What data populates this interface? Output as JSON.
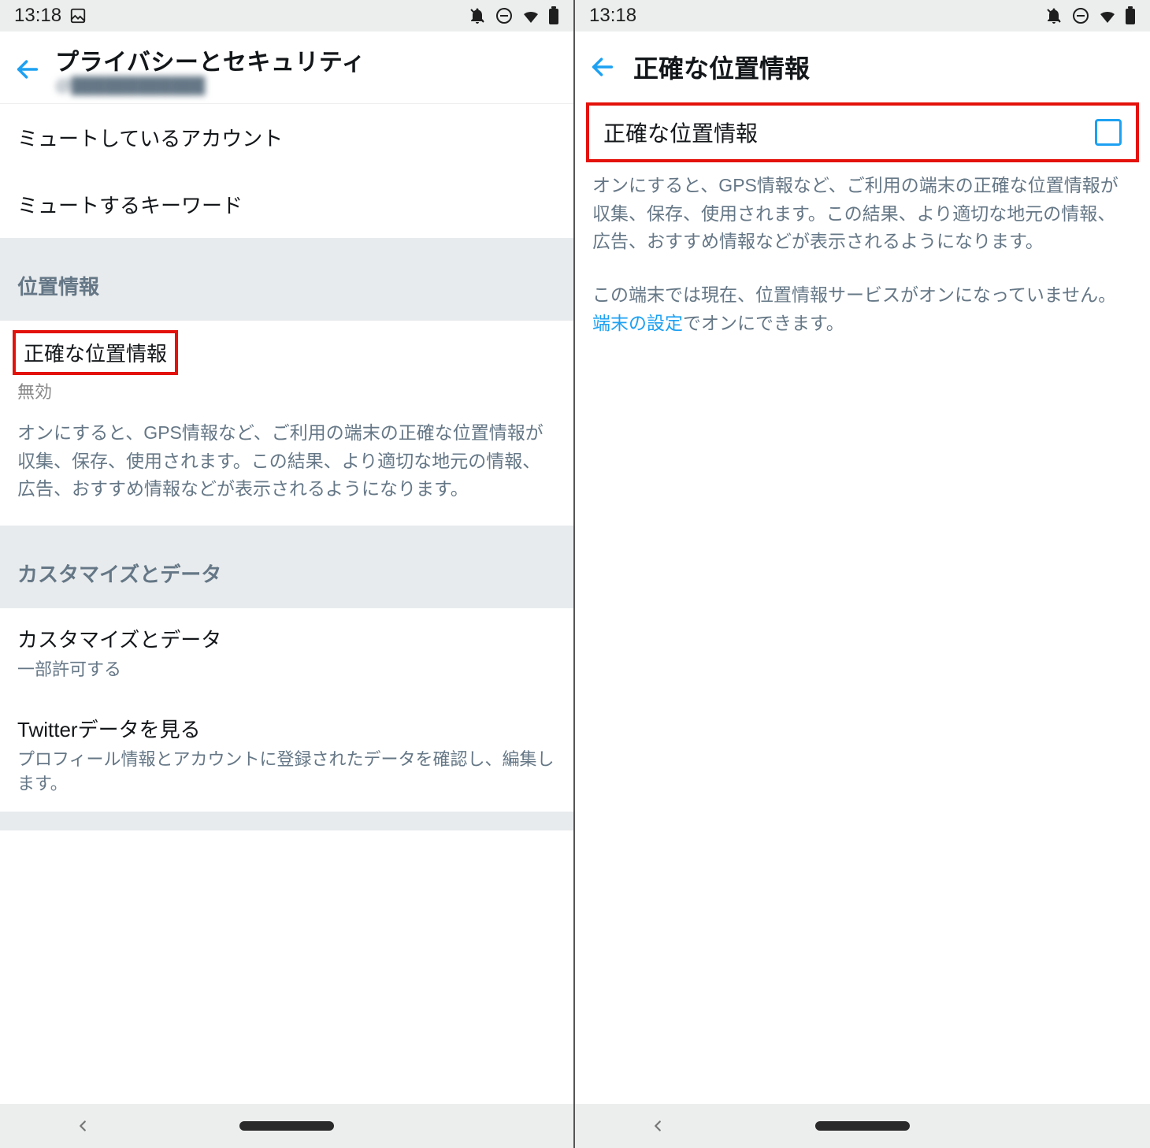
{
  "statusbar": {
    "time": "13:18"
  },
  "left": {
    "title": "プライバシーとセキュリティ",
    "handle": "@████████████",
    "items": {
      "muted_accounts": "ミュートしているアカウント",
      "muted_keywords": "ミュートするキーワード"
    },
    "section_location": "位置情報",
    "precise_location": {
      "label": "正確な位置情報",
      "state": "無効",
      "description": "オンにすると、GPS情報など、ご利用の端末の正確な位置情報が収集、保存、使用されます。この結果、より適切な地元の情報、広告、おすすめ情報などが表示されるようになります。"
    },
    "section_customize": "カスタマイズとデータ",
    "customize": {
      "label": "カスタマイズとデータ",
      "caption": "一部許可する"
    },
    "twitter_data": {
      "label": "Twitterデータを見る",
      "caption": "プロフィール情報とアカウントに登録されたデータを確認し、編集します。"
    }
  },
  "right": {
    "title": "正確な位置情報",
    "check_label": "正確な位置情報",
    "description": "オンにすると、GPS情報など、ご利用の端末の正確な位置情報が収集、保存、使用されます。この結果、より適切な地元の情報、広告、おすすめ情報などが表示されるようになります。",
    "service_note_before": "この端末では現在、位置情報サービスがオンになっていません。",
    "service_link": "端末の設定",
    "service_note_after": "でオンにできます。"
  }
}
